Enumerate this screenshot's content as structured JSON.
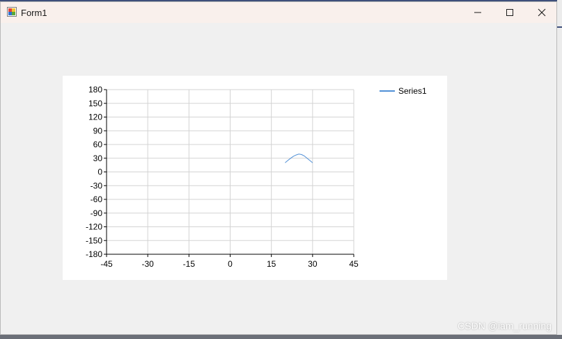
{
  "window": {
    "title": "Form1",
    "icon": "winforms-app-icon",
    "controls": [
      "minimize-icon",
      "maximize-icon",
      "close-icon"
    ]
  },
  "chart_data": {
    "type": "line",
    "xlim": [
      -45,
      45
    ],
    "ylim": [
      -180,
      180
    ],
    "xticks": [
      -45,
      -30,
      -15,
      0,
      15,
      30,
      45
    ],
    "yticks": [
      180,
      150,
      120,
      90,
      60,
      30,
      0,
      -30,
      -60,
      -90,
      -120,
      -150,
      -180
    ],
    "grid": true,
    "legend_placement": "top-right",
    "series": [
      {
        "name": "Series1",
        "color": "#4f8fd6",
        "x": [
          20,
          21,
          22,
          23,
          24,
          25,
          26,
          27,
          28,
          29,
          30
        ],
        "y": [
          20,
          25,
          30,
          34,
          37,
          39,
          38,
          35,
          30,
          25,
          20
        ]
      }
    ]
  },
  "watermark": "CSDN @iam_running",
  "colors": {
    "titlebar": "#f9f0ec",
    "client": "#f0f0f0",
    "grid": "#d3d3d3",
    "axis": "#000000"
  }
}
